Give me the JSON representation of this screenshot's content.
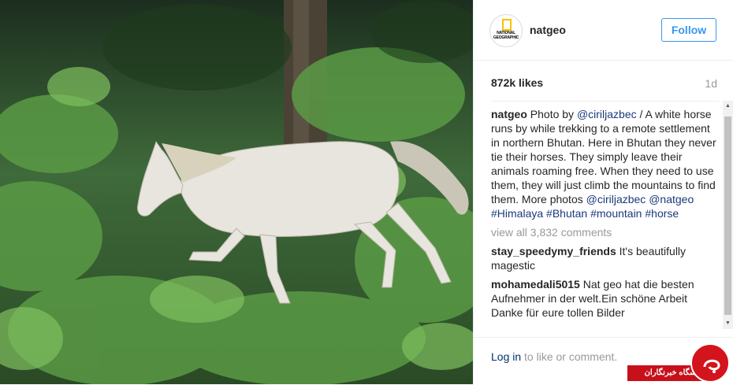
{
  "post": {
    "image_alt": "White horse running through green forest undergrowth in Bhutan",
    "colors": {
      "accent": "#3897f0",
      "link": "#1a3a7a",
      "muted": "#999999"
    }
  },
  "header": {
    "avatar_text": "NATIONAL GEOGRAPHIC",
    "username": "natgeo",
    "follow_label": "Follow"
  },
  "stats": {
    "likes": "872k likes",
    "age": "1d"
  },
  "caption": {
    "user": "natgeo",
    "t1": "Photo by ",
    "m1": "@ciriljazbec",
    "t2": " / A white horse runs by while trekking to a remote settlement in northern Bhutan. Here in Bhutan they never tie their horses. They simply leave their animals roaming free. When they need to use them, they will just climb the mountains to find them. More photos ",
    "m2": "@ciriljazbec",
    "m3": "@natgeo",
    "h1": "#Himalaya",
    "h2": "#Bhutan",
    "h3": "#mountain",
    "h4": "#horse"
  },
  "view_all": "view all 3,832 comments",
  "comments": [
    {
      "user": "stay_speedymy_friends",
      "text": "It's beautifully magestic"
    },
    {
      "user": "mohamedali5015",
      "text": "Nat geo hat die besten Aufnehmer in der welt.Ein schöne Arbeit Danke für eure tollen Bilder"
    }
  ],
  "footer": {
    "login": "Log in",
    "rest": " to like or comment.",
    "more": "•••"
  },
  "watermark": {
    "banner": "باشگاه خبرنگاران"
  }
}
